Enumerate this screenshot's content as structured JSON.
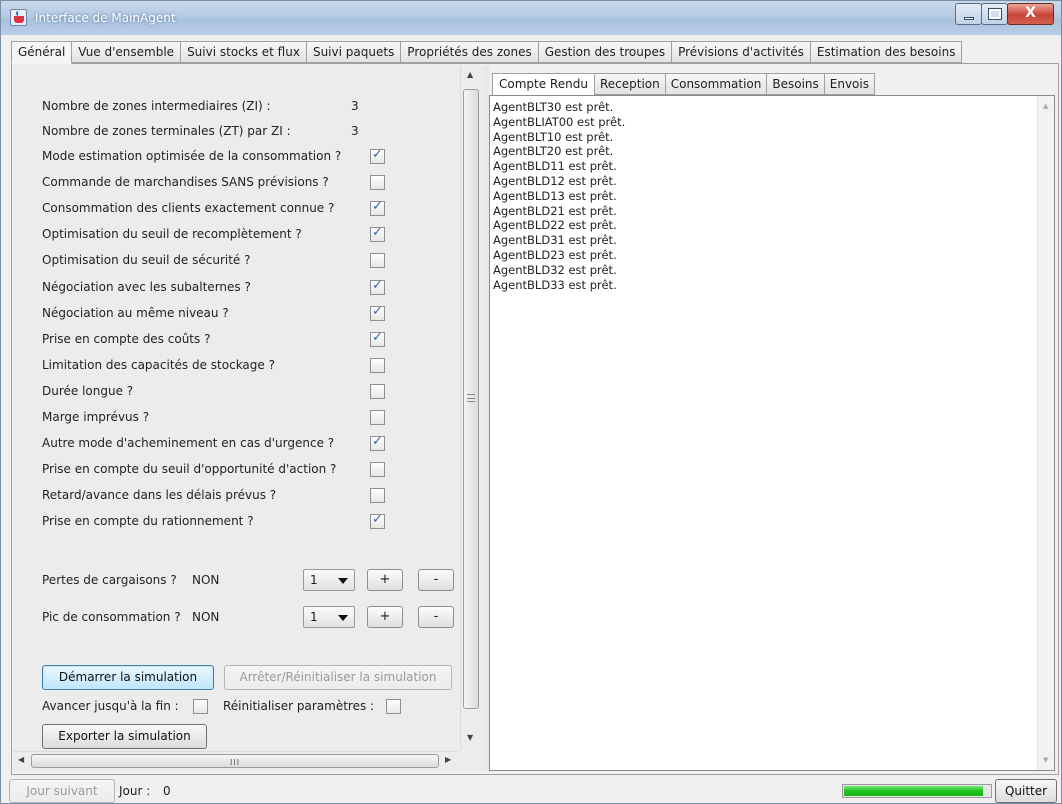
{
  "window": {
    "title": "Interface de MainAgent"
  },
  "main_tabs": [
    {
      "label": "Général"
    },
    {
      "label": "Vue d'ensemble"
    },
    {
      "label": "Suivi stocks et flux"
    },
    {
      "label": "Suivi paquets"
    },
    {
      "label": "Propriétés des zones"
    },
    {
      "label": "Gestion des troupes"
    },
    {
      "label": "Prévisions d'activités"
    },
    {
      "label": "Estimation des besoins"
    }
  ],
  "general": {
    "zones": [
      {
        "label": "Nombre de zones intermediaires (ZI) :",
        "value": "3"
      },
      {
        "label": "Nombre de zones terminales (ZT) par ZI :",
        "value": "3"
      }
    ],
    "options": [
      {
        "label": "Mode estimation optimisée de la consommation ?",
        "checked": true
      },
      {
        "label": "Commande de marchandises SANS prévisions ?",
        "checked": false
      },
      {
        "label": "Consommation des clients exactement connue ?",
        "checked": true
      },
      {
        "label": "Optimisation du seuil de recomplètement ?",
        "checked": true
      },
      {
        "label": "Optimisation du seuil de sécurité ?",
        "checked": false
      },
      {
        "label": "Négociation avec les subalternes ?",
        "checked": true
      },
      {
        "label": "Négociation au même niveau ?",
        "checked": true
      },
      {
        "label": "Prise en compte des coûts ?",
        "checked": true
      },
      {
        "label": "Limitation des capacités de stockage ?",
        "checked": false
      },
      {
        "label": "Durée longue ?",
        "checked": false
      },
      {
        "label": "Marge imprévus ?",
        "checked": false
      },
      {
        "label": "Autre mode d'acheminement en cas d'urgence ?",
        "checked": true
      },
      {
        "label": "Prise en compte du seuil d'opportunité d'action ?",
        "checked": false
      },
      {
        "label": "Retard/avance dans les délais prévus ?",
        "checked": false
      },
      {
        "label": "Prise en compte du rationnement ?",
        "checked": true
      }
    ],
    "pertes": {
      "label": "Pertes de cargaisons ?",
      "state": "NON",
      "combo": "1",
      "plus": "+",
      "minus": "-"
    },
    "pic": {
      "label": "Pic de consommation ?",
      "state": "NON",
      "combo": "1",
      "plus": "+",
      "minus": "-"
    },
    "start_button": "Démarrer la simulation",
    "stop_button": "Arrêter/Réinitialiser la simulation",
    "advance_label": "Avancer jusqu'à la fin :",
    "advance_checked": false,
    "reset_params_label": "Réinitialiser paramètres :",
    "reset_params_checked": false,
    "export_button": "Exporter la simulation"
  },
  "right_tabs": [
    {
      "label": "Compte Rendu"
    },
    {
      "label": "Reception"
    },
    {
      "label": "Consommation"
    },
    {
      "label": "Besoins"
    },
    {
      "label": "Envois"
    }
  ],
  "log_lines": [
    "AgentBLT30 est prêt.",
    "AgentBLIAT00 est prêt.",
    "AgentBLT10 est prêt.",
    "AgentBLT20 est prêt.",
    "AgentBLD11 est prêt.",
    "AgentBLD12 est prêt.",
    "AgentBLD13 est prêt.",
    "AgentBLD21 est prêt.",
    "AgentBLD22 est prêt.",
    "AgentBLD31 est prêt.",
    "AgentBLD23 est prêt.",
    "AgentBLD32 est prêt.",
    "AgentBLD33 est prêt."
  ],
  "status": {
    "next_day_button": "Jour suivant",
    "day_label": "Jour :",
    "day_value": "0",
    "progress": 0.95,
    "quit_button": "Quitter"
  },
  "icons": {
    "app": "java-cup-icon",
    "minimize": "minimize-icon",
    "maximize": "maximize-icon",
    "close": "close-icon",
    "combo_arrow": "chevron-down-icon",
    "scroll_up": "scroll-up-arrow-icon",
    "scroll_down": "scroll-down-arrow-icon"
  },
  "colors": {
    "progress_fill": "#1fc41f",
    "checkmark": "#3d5fa8",
    "focused_button": "#bee6fd"
  }
}
